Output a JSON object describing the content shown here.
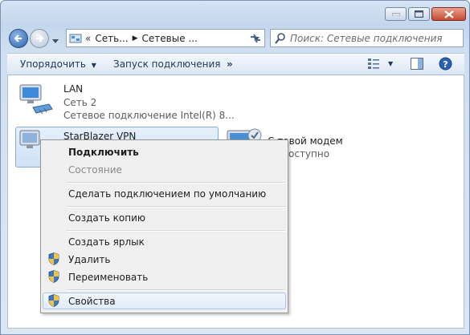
{
  "address": {
    "prefix": "«",
    "crumb1": "Сеть...",
    "crumb2": "Сетевые ..."
  },
  "search": {
    "placeholder": "Поиск: Сетевые подключения"
  },
  "toolbar": {
    "organize": "Упорядочить",
    "start_connection": "Запуск подключения",
    "more": "»"
  },
  "connections": [
    {
      "name": "LAN",
      "status": "Сеть  2",
      "device": "Сетевое подключение Intel(R) 8..."
    },
    {
      "name": "StarBlazer VPN"
    },
    {
      "name": "Сетевой модем",
      "name_visible": "С  тевой модем",
      "status": "оступно"
    }
  ],
  "context_menu": {
    "items": [
      {
        "label": "Подключить",
        "bold": true
      },
      {
        "label": "Состояние",
        "disabled": true
      },
      {
        "label": "Сделать подключением по умолчанию"
      },
      {
        "label": "Создать копию"
      },
      {
        "label": "Создать ярлык"
      },
      {
        "label": "Удалить",
        "shield": true
      },
      {
        "label": "Переименовать",
        "shield": true
      },
      {
        "label": "Свойства",
        "shield": true,
        "highlighted": true
      }
    ]
  },
  "colors": {
    "frame": "#c3d6ec",
    "highlight": "#cfe2f6",
    "toolbar_text": "#1e395b",
    "close_button": "#c74a33"
  }
}
